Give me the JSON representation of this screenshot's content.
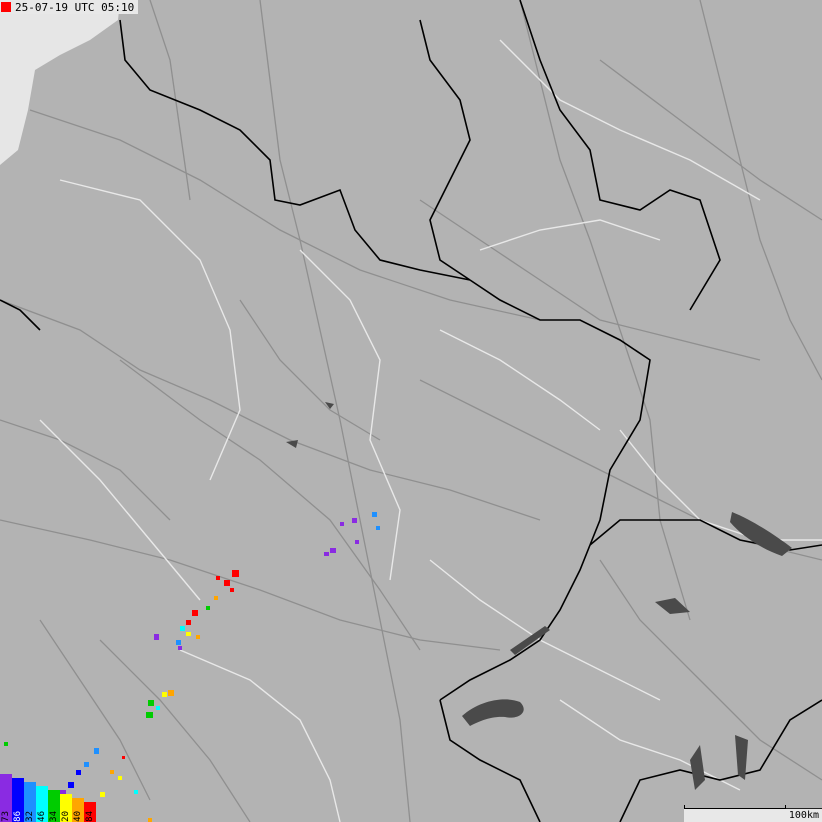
{
  "timestamp": "25-07-19 UTC 05:10",
  "scale_label": "100km",
  "colors": {
    "land": "#b3b3b3",
    "sea": "#e6e6e6",
    "lake": "#4a4a4a",
    "road": "#8f8f8f",
    "region_border": "#e8e8e8",
    "country_border": "#000000",
    "marker": "#ff0000"
  },
  "legend": [
    {
      "label": "73",
      "color": "#8a2be2"
    },
    {
      "label": "86",
      "color": "#0000ff"
    },
    {
      "label": "32",
      "color": "#1e90ff"
    },
    {
      "label": "46",
      "color": "#00ffff"
    },
    {
      "label": "34",
      "color": "#00cc00"
    },
    {
      "label": "20",
      "color": "#ffff00"
    },
    {
      "label": "40",
      "color": "#ffa500"
    },
    {
      "label": "84",
      "color": "#ff0000"
    }
  ]
}
